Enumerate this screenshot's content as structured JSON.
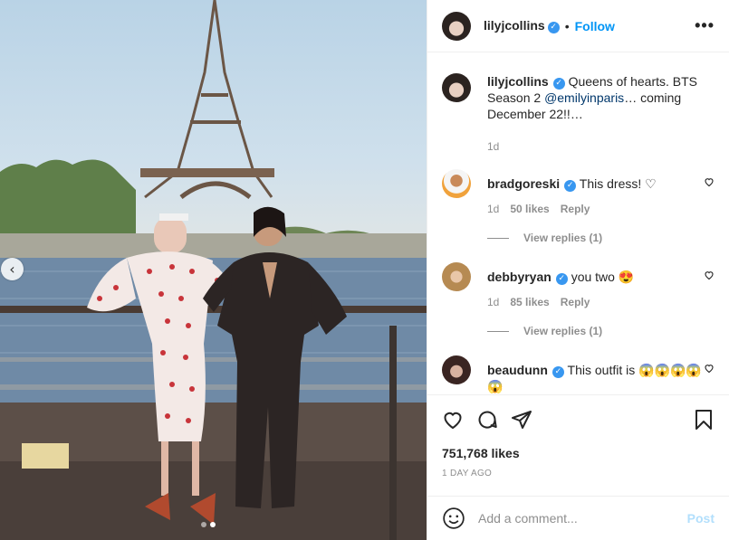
{
  "post": {
    "author": "lilyjcollins",
    "follow_label": "Follow",
    "separator": "•",
    "more_label": "•••",
    "caption": {
      "username": "lilyjcollins",
      "text_before": "Queens of hearts. BTS Season 2 ",
      "mention": "@emilyinparis",
      "text_after": "… coming December 22!!…",
      "age": "1d"
    },
    "photo": {
      "carousel_dots": 2,
      "active_dot": 1
    }
  },
  "comments": [
    {
      "username": "bradgoreski",
      "text": "This dress! ♡",
      "age": "1d",
      "likes": "50 likes",
      "reply_label": "Reply",
      "view_replies": "View replies (1)"
    },
    {
      "username": "debbyryan",
      "text": "you two 😍",
      "age": "1d",
      "likes": "85 likes",
      "reply_label": "Reply",
      "view_replies": "View replies (1)"
    },
    {
      "username": "beaudunn",
      "text": "This outfit is 😱😱😱😱😱"
    }
  ],
  "footer": {
    "likes_count": "751,768 likes",
    "date": "1 DAY AGO",
    "comment_placeholder": "Add a comment...",
    "post_label": "Post"
  },
  "icons": {
    "like": "heart-icon",
    "comment": "comment-icon",
    "share": "share-icon",
    "save": "bookmark-icon",
    "emoji": "emoji-icon",
    "verified": "verified-badge-icon",
    "carousel_prev": "chevron-left-icon"
  },
  "colors": {
    "accent": "#0095f6",
    "verified": "#3897f0",
    "muted": "#8e8e8e",
    "post_disabled": "#b2dffc"
  }
}
